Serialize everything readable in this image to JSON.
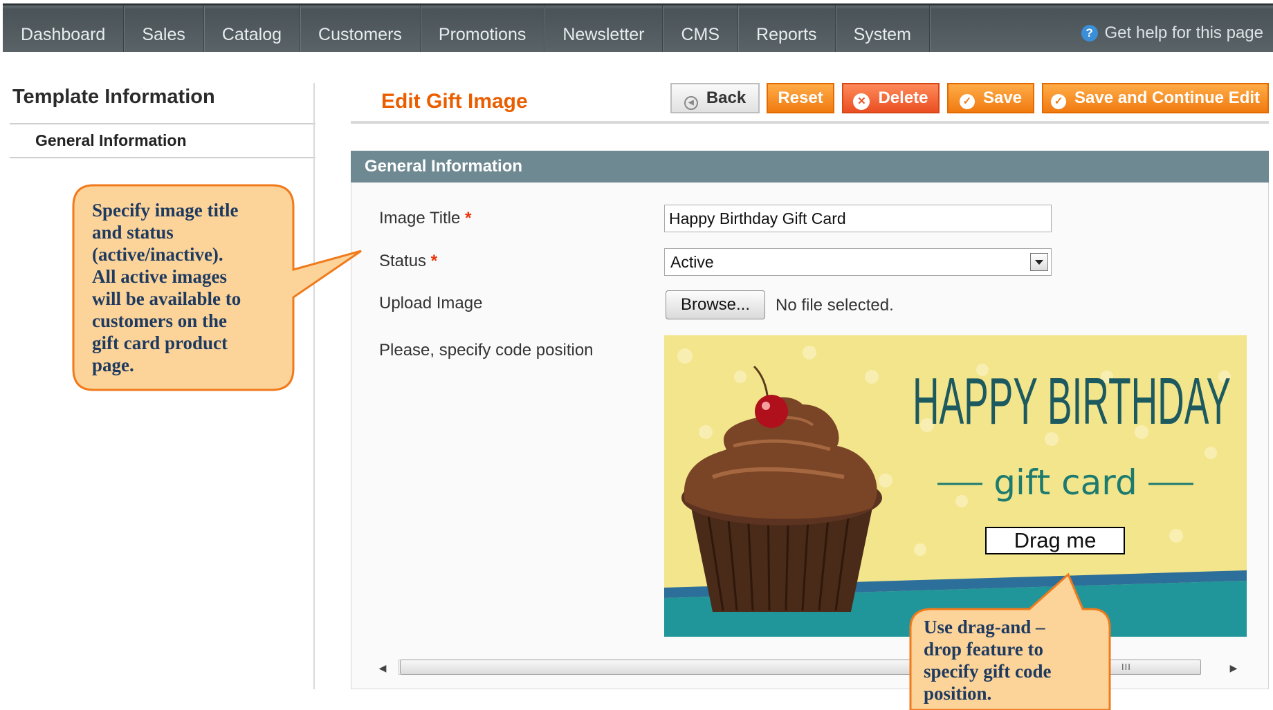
{
  "nav": {
    "items": [
      "Dashboard",
      "Sales",
      "Catalog",
      "Customers",
      "Promotions",
      "Newsletter",
      "CMS",
      "Reports",
      "System"
    ],
    "help": "Get help for this page"
  },
  "sidebar": {
    "title": "Template Information",
    "items": [
      "General Information"
    ]
  },
  "header": {
    "title": "Edit Gift Image",
    "buttons": {
      "back": "Back",
      "reset": "Reset",
      "delete": "Delete",
      "save": "Save",
      "save_continue": "Save and Continue Edit"
    }
  },
  "section": {
    "title": "General Information",
    "fields": {
      "image_title_label": "Image Title",
      "image_title_value": "Happy Birthday Gift Card",
      "status_label": "Status",
      "status_value": "Active",
      "upload_label": "Upload Image",
      "browse_label": "Browse...",
      "no_file": "No file selected.",
      "code_position_label": "Please, specify code position",
      "required_mark": "*"
    }
  },
  "giftcard": {
    "heading": "HAPPY BIRTHDAY",
    "subheading": "gift card",
    "drag_label": "Drag me"
  },
  "callouts": {
    "left": [
      "Specify image title",
      "and status",
      "(active/inactive).",
      "All active images",
      "will be available to",
      "customers on the",
      "gift card product",
      "page."
    ],
    "bottom": [
      "Use drag-and –",
      "drop feature to",
      "specify gift code",
      "position."
    ]
  },
  "colors": {
    "accent_orange": "#eb5e00",
    "section_header": "#6f8992",
    "callout_fill": "#fcd49a",
    "callout_border": "#f07a1c",
    "card_background": "#f3e58c",
    "card_text": "#1d5a5f"
  }
}
